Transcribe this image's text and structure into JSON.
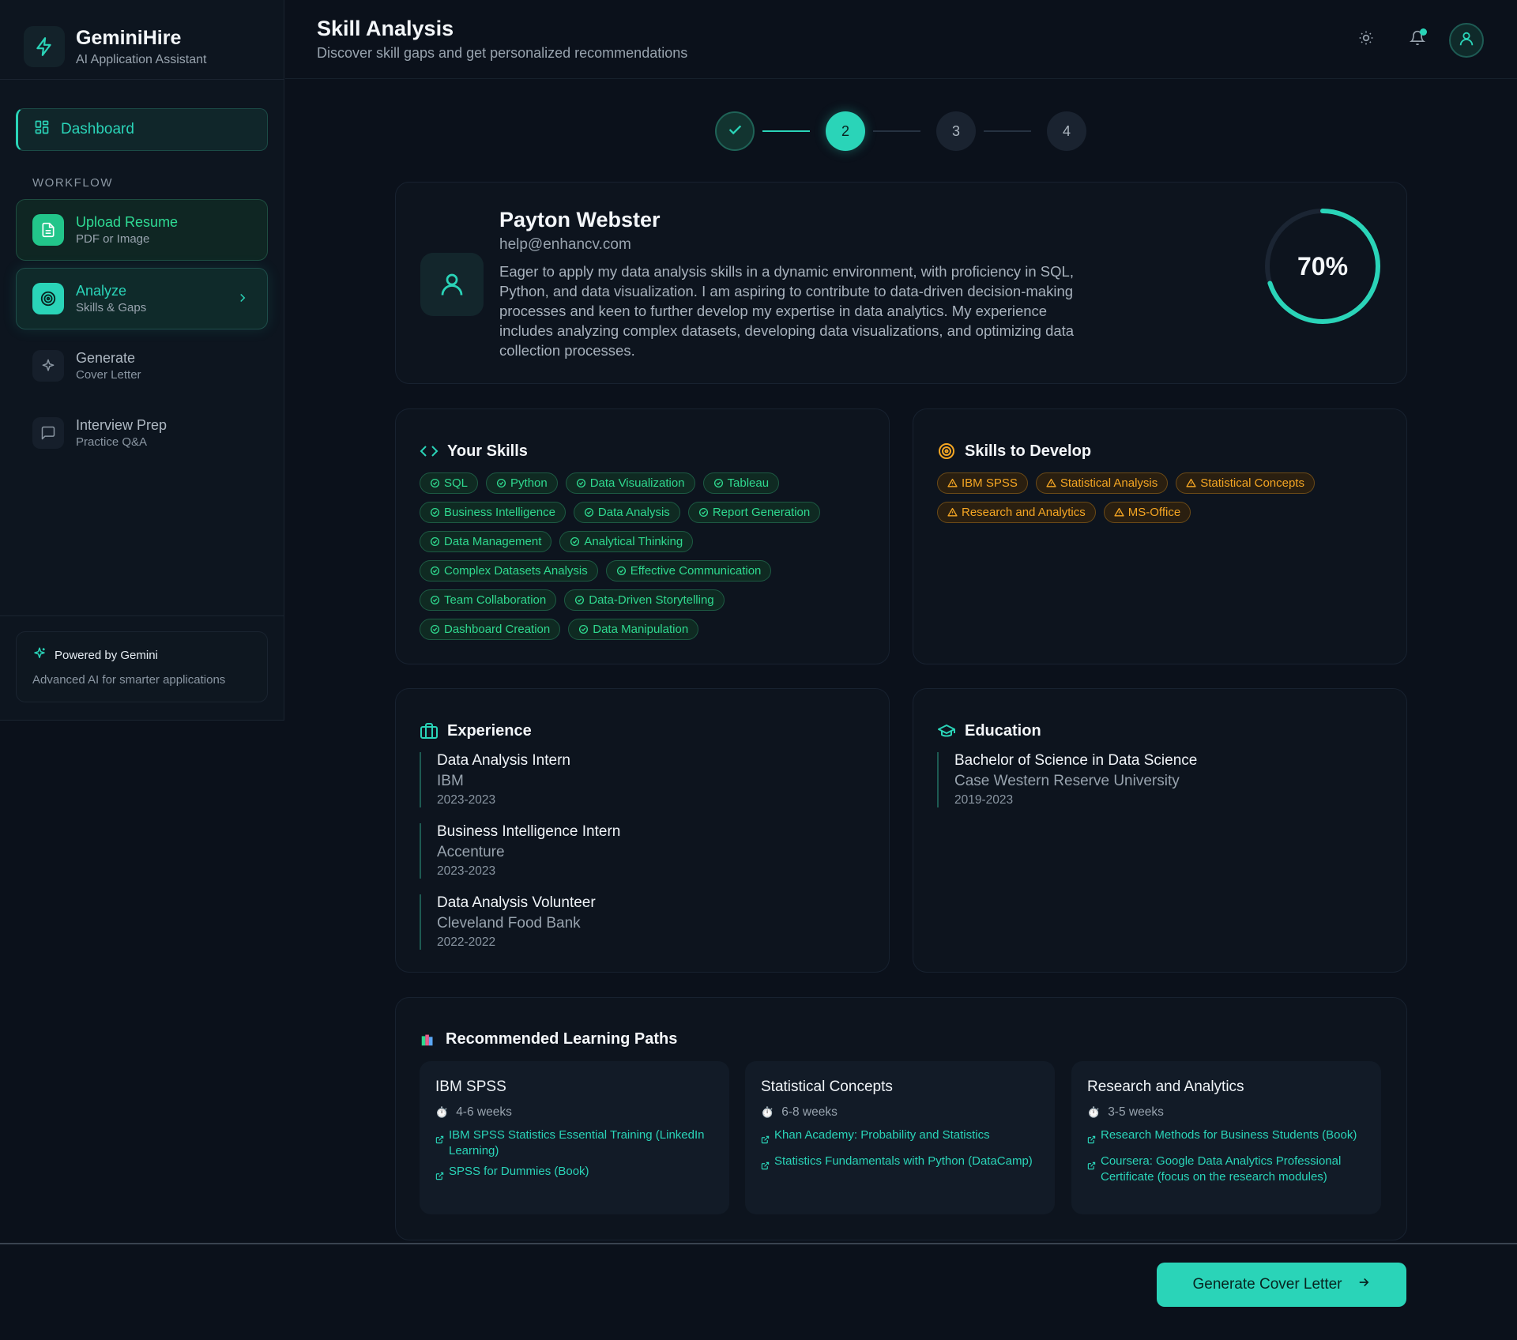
{
  "app": {
    "name": "GeminiHire",
    "subtitle": "AI Application Assistant"
  },
  "sidebar": {
    "dashboard_label": "Dashboard",
    "workflow_label": "WORKFLOW",
    "items": [
      {
        "title": "Upload Resume",
        "sub": "PDF or Image",
        "state": "done",
        "icon": "file-icon"
      },
      {
        "title": "Analyze",
        "sub": "Skills & Gaps",
        "state": "active",
        "icon": "target-icon"
      },
      {
        "title": "Generate",
        "sub": "Cover Letter",
        "state": "pending",
        "icon": "sparkle-icon"
      },
      {
        "title": "Interview Prep",
        "sub": "Practice Q&A",
        "state": "pending",
        "icon": "chat-icon"
      }
    ],
    "powered_title": "Powered by Gemini",
    "powered_sub": "Advanced AI for smarter applications"
  },
  "header": {
    "title": "Skill Analysis",
    "subtitle": "Discover skill gaps and get personalized recommendations"
  },
  "stepper": {
    "steps": [
      "",
      "2",
      "3",
      "4"
    ],
    "current": 2
  },
  "profile": {
    "name": "Payton Webster",
    "email": "help@enhancv.com",
    "summary": "Eager to apply my data analysis skills in a dynamic environment, with proficiency in SQL, Python, and data visualization. I am aspiring to contribute to data-driven decision-making processes and keen to further develop my expertise in data analytics. My experience includes analyzing complex datasets, developing data visualizations, and optimizing data collection processes.",
    "match_score": "70%",
    "match_fraction": 0.7
  },
  "skills": {
    "title": "Your Skills",
    "items": [
      "SQL",
      "Python",
      "Data Visualization",
      "Tableau",
      "Business Intelligence",
      "Data Analysis",
      "Report Generation",
      "Data Management",
      "Analytical Thinking",
      "Complex Datasets Analysis",
      "Effective Communication",
      "Team Collaboration",
      "Data-Driven Storytelling",
      "Dashboard Creation",
      "Data Manipulation"
    ]
  },
  "develop": {
    "title": "Skills to Develop",
    "items": [
      "IBM SPSS",
      "Statistical Analysis",
      "Statistical Concepts",
      "Research and Analytics",
      "MS-Office"
    ]
  },
  "experience": {
    "title": "Experience",
    "items": [
      {
        "role": "Data Analysis Intern",
        "org": "IBM",
        "dates": "2023-2023"
      },
      {
        "role": "Business Intelligence Intern",
        "org": "Accenture",
        "dates": "2023-2023"
      },
      {
        "role": "Data Analysis Volunteer",
        "org": "Cleveland Food Bank",
        "dates": "2022-2022"
      }
    ]
  },
  "education": {
    "title": "Education",
    "items": [
      {
        "degree": "Bachelor of Science in Data Science",
        "school": "Case Western Reserve University",
        "dates": "2019-2023"
      }
    ]
  },
  "learning": {
    "title": "Recommended Learning Paths",
    "paths": [
      {
        "title": "IBM SPSS",
        "duration": "4-6 weeks",
        "links": [
          "IBM SPSS Statistics Essential Training (LinkedIn Learning)",
          "SPSS for Dummies (Book)"
        ]
      },
      {
        "title": "Statistical Concepts",
        "duration": "6-8 weeks",
        "links": [
          "Khan Academy: Probability and Statistics",
          "Statistics Fundamentals with Python (DataCamp)"
        ]
      },
      {
        "title": "Research and Analytics",
        "duration": "3-5 weeks",
        "links": [
          "Research Methods for Business Students (Book)",
          "Coursera: Google Data Analytics Professional Certificate (focus on the research modules)"
        ]
      }
    ]
  },
  "footer": {
    "cta_label": "Generate Cover Letter"
  },
  "colors": {
    "accent": "#2ad4b8",
    "success": "#2fd98f",
    "warning": "#f5a623",
    "background": "#0b111b"
  }
}
